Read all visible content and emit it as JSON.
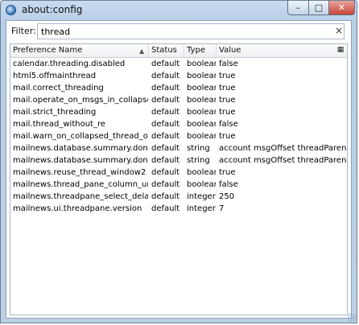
{
  "window": {
    "title": "about:config"
  },
  "filter": {
    "label": "Filter:",
    "value": "thread",
    "clear_symbol": "×"
  },
  "columns": {
    "name": "Preference Name",
    "status": "Status",
    "type": "Type",
    "value": "Value"
  },
  "rows": [
    {
      "name": "calendar.threading.disabled",
      "status": "default",
      "type": "boolean",
      "value": "false"
    },
    {
      "name": "html5.offmainthread",
      "status": "default",
      "type": "boolean",
      "value": "true"
    },
    {
      "name": "mail.correct_threading",
      "status": "default",
      "type": "boolean",
      "value": "true"
    },
    {
      "name": "mail.operate_on_msgs_in_collapsed_t...",
      "status": "default",
      "type": "boolean",
      "value": "true"
    },
    {
      "name": "mail.strict_threading",
      "status": "default",
      "type": "boolean",
      "value": "true"
    },
    {
      "name": "mail.thread_without_re",
      "status": "default",
      "type": "boolean",
      "value": "false"
    },
    {
      "name": "mail.warn_on_collapsed_thread_opera...",
      "status": "default",
      "type": "boolean",
      "value": "true"
    },
    {
      "name": "mailnews.database.summary.dontPre...",
      "status": "default",
      "type": "string",
      "value": "account msgOffset threadParent m..."
    },
    {
      "name": "mailnews.database.summary.dontPre...",
      "status": "default",
      "type": "string",
      "value": "account msgOffset threadParent m..."
    },
    {
      "name": "mailnews.reuse_thread_window2",
      "status": "default",
      "type": "boolean",
      "value": "true"
    },
    {
      "name": "mailnews.thread_pane_column_unthr...",
      "status": "default",
      "type": "boolean",
      "value": "false"
    },
    {
      "name": "mailnews.threadpane_select_delay",
      "status": "default",
      "type": "integer",
      "value": "250"
    },
    {
      "name": "mailnews.ui.threadpane.version",
      "status": "default",
      "type": "integer",
      "value": "7"
    }
  ],
  "icons": {
    "app": "thunderbird-icon",
    "sort": "sort-ascending-icon",
    "column_picker": "column-picker-icon"
  }
}
